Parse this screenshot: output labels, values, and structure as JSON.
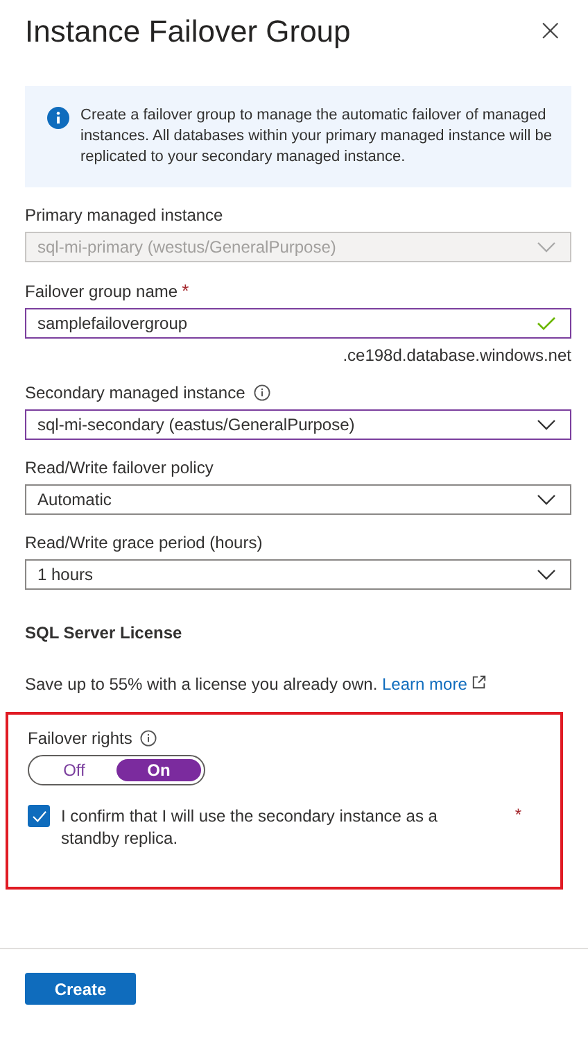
{
  "panel": {
    "title": "Instance Failover Group",
    "close": "×"
  },
  "info": {
    "text": "Create a failover group to manage the automatic failover of managed instances. All databases within your primary managed instance will be replicated to your secondary managed instance."
  },
  "fields": [
    {
      "kind": "dropdown",
      "label": "Primary managed instance",
      "value": "sql-mi-primary (westus/GeneralPurpose)",
      "disabled": true
    },
    {
      "kind": "text",
      "label": "Failover group name",
      "required_mark": "*",
      "value": "samplefailovergroup",
      "disabled": false,
      "valid": true,
      "suffix": ".ce198d.database.windows.net"
    },
    {
      "kind": "dropdown",
      "label": "Secondary managed instance",
      "value": "sql-mi-secondary (eastus/GeneralPurpose)",
      "disabled": false,
      "info": true,
      "focused": true
    },
    {
      "kind": "dropdown",
      "label": "Read/Write failover policy",
      "value": "Automatic",
      "disabled": false
    },
    {
      "kind": "dropdown",
      "label": "Read/Write grace period (hours)",
      "value": "1 hours",
      "disabled": false
    }
  ],
  "license": {
    "heading": "SQL Server License",
    "text": "Save up to 55% with a license you already own.",
    "link": "Learn more"
  },
  "failover_rights": {
    "highlighted": true,
    "label": "Failover rights",
    "options": [
      {
        "label": "Off",
        "selected": false
      },
      {
        "label": "On",
        "selected": true
      }
    ],
    "confirm": {
      "label": "I confirm that I will use the secondary instance as a standby replica.",
      "checked": true,
      "required_mark": "*"
    }
  },
  "footer": {
    "button": "Create"
  }
}
